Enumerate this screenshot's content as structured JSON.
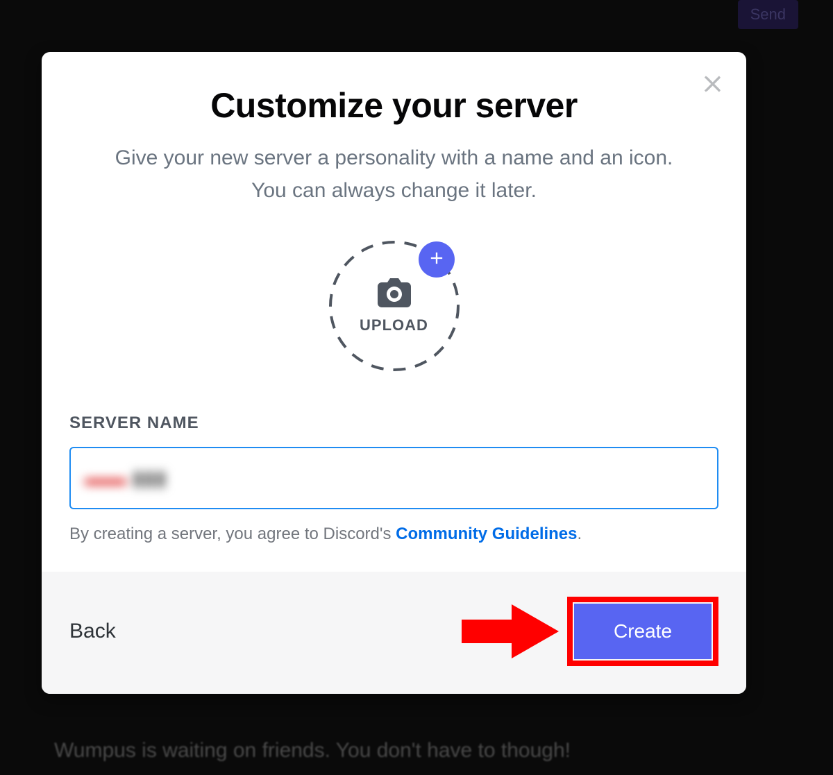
{
  "background": {
    "send_button": "Send",
    "bottom_text": "Wumpus is waiting on friends. You don't have to though!"
  },
  "modal": {
    "title": "Customize your server",
    "subtitle": "Give your new server a personality with a name and an icon. You can always change it later.",
    "upload": {
      "label": "UPLOAD"
    },
    "field": {
      "label": "SERVER NAME",
      "value": "",
      "blurred": true
    },
    "guidelines": {
      "prefix": "By creating a server, you agree to Discord's ",
      "link_text": "Community Guidelines",
      "suffix": "."
    },
    "footer": {
      "back_label": "Back",
      "create_label": "Create"
    }
  },
  "annotation": {
    "arrow_color": "#ff0000",
    "highlight_color": "#ff0000"
  },
  "colors": {
    "accent": "#5865f2",
    "link": "#006ce7",
    "text_muted": "#6a7480",
    "input_border_focus": "#1f8cf2"
  }
}
